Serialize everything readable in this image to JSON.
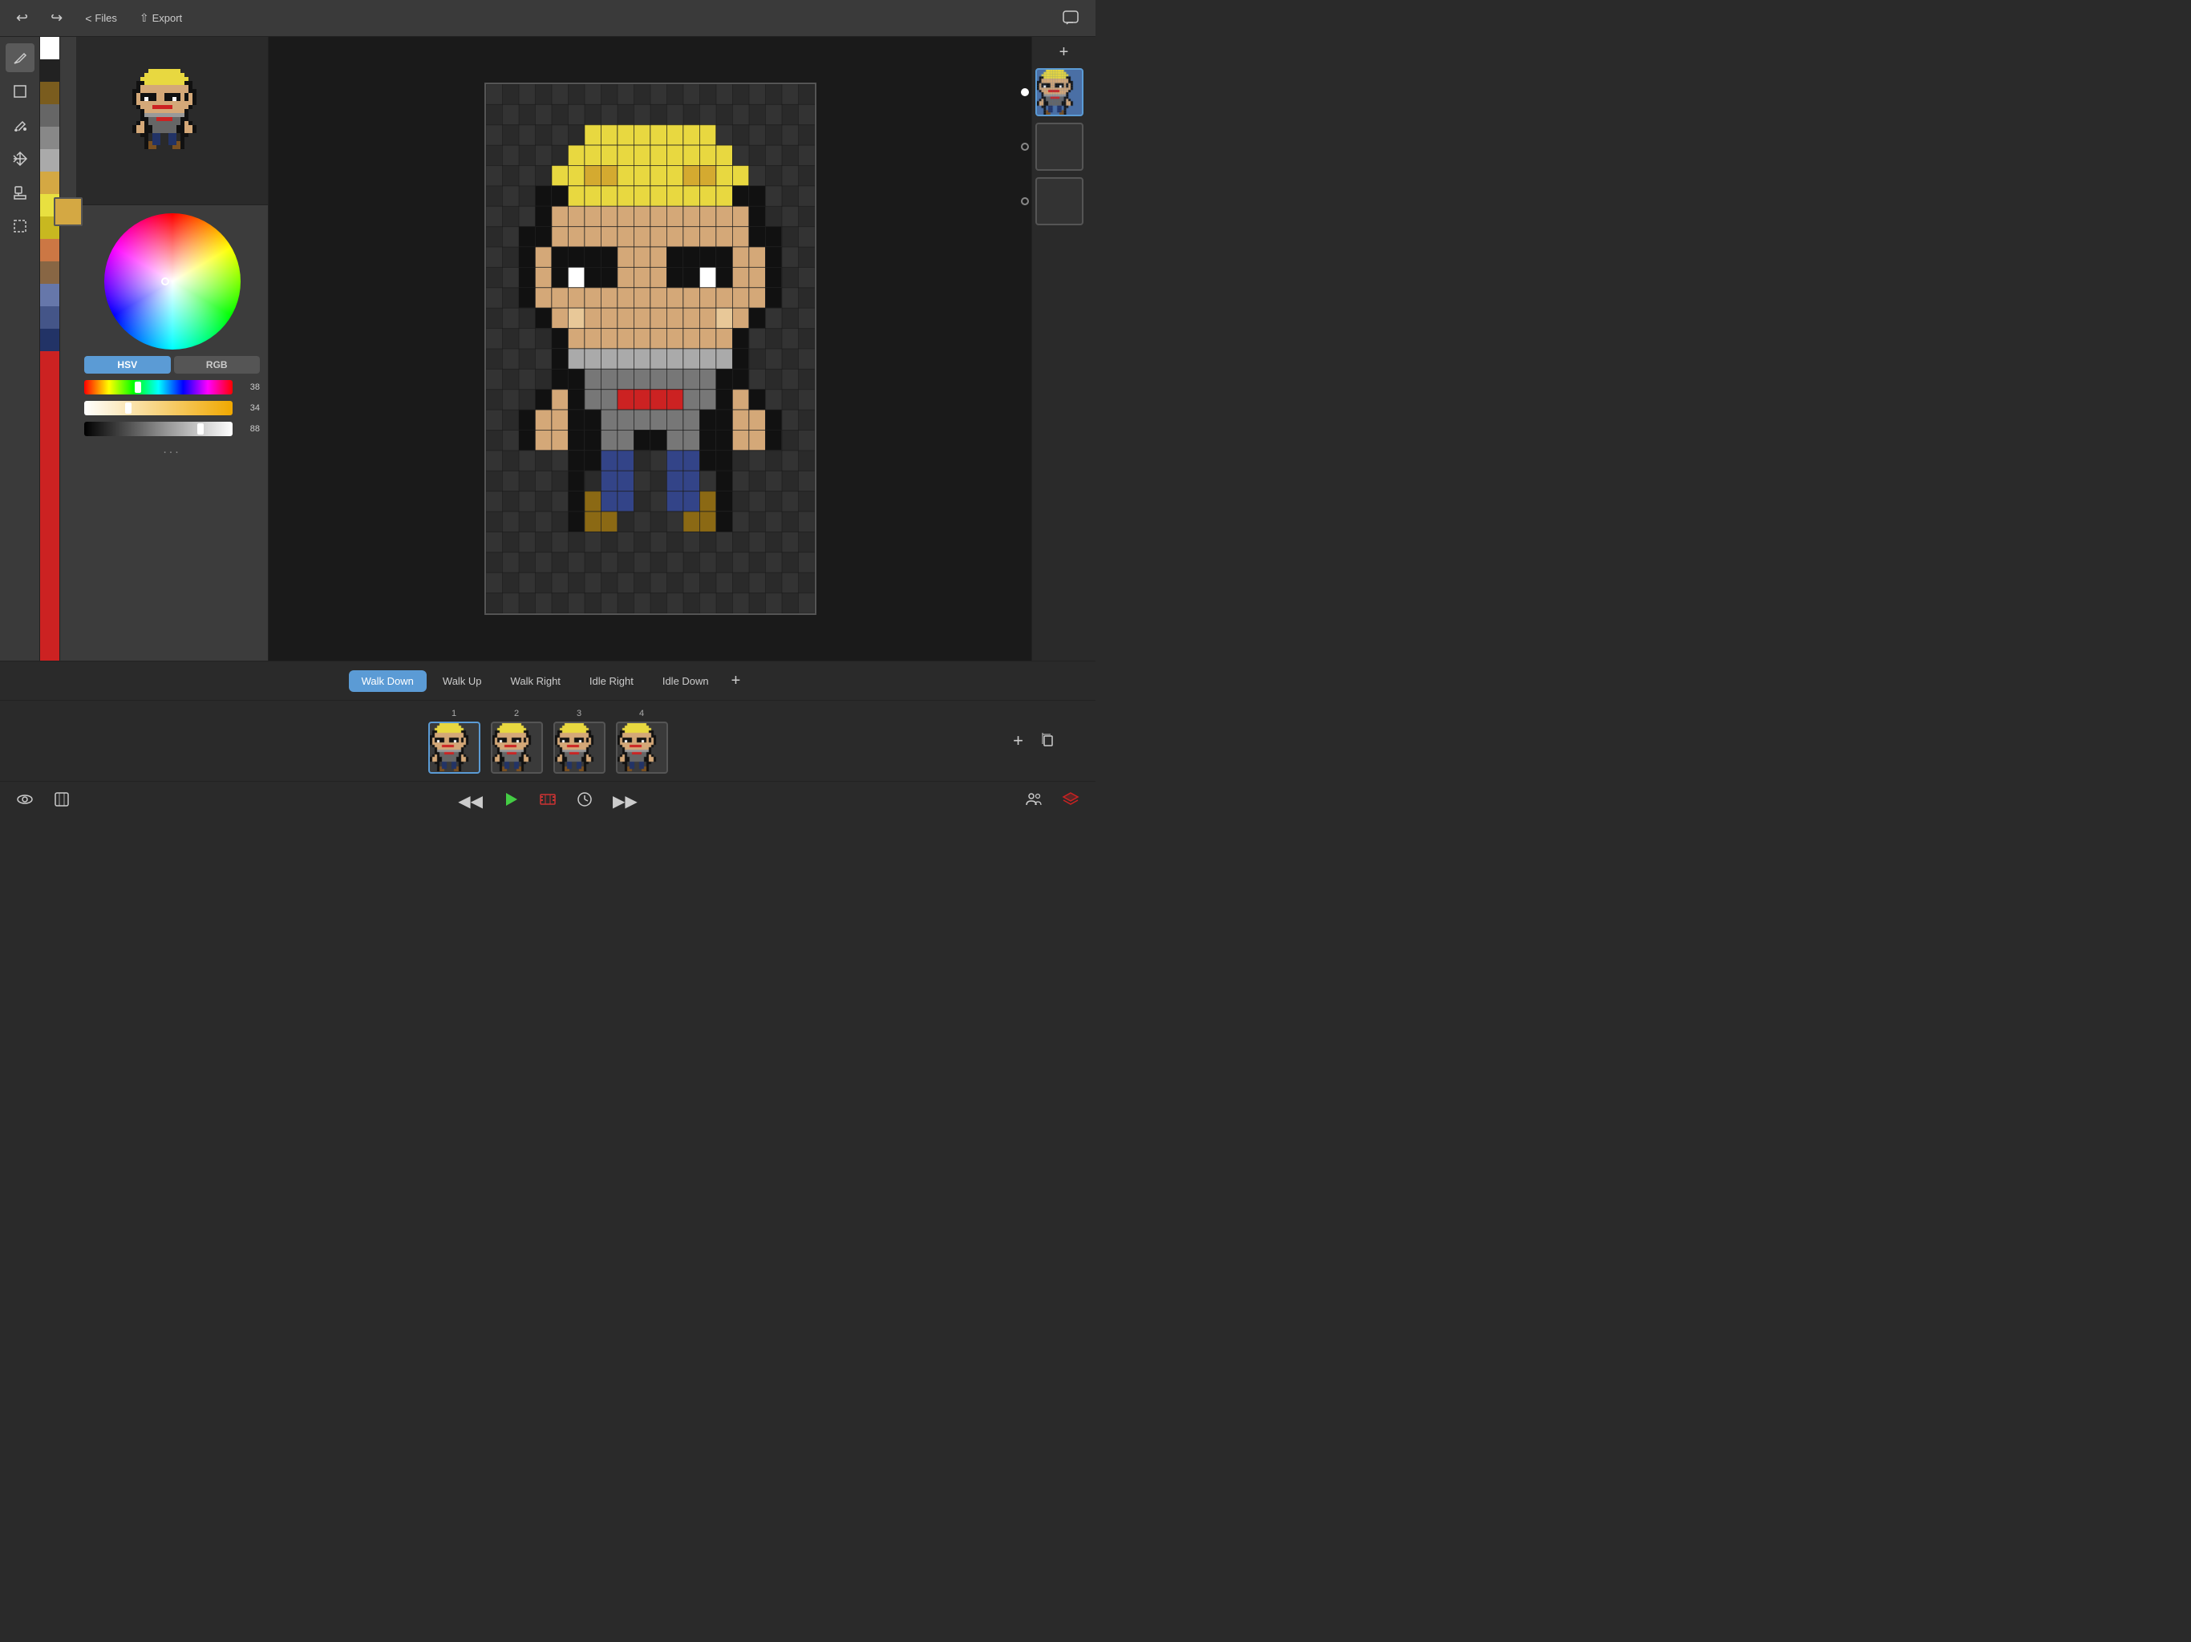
{
  "toolbar": {
    "undo_label": "↩",
    "redo_label": "↪",
    "files_label": "Files",
    "export_label": "Export",
    "chat_label": "💬",
    "add_label": "+"
  },
  "tools": [
    {
      "name": "pencil",
      "icon": "✏️",
      "active": true
    },
    {
      "name": "square",
      "icon": "□"
    },
    {
      "name": "fill",
      "icon": "🪣"
    },
    {
      "name": "move",
      "icon": "✥"
    },
    {
      "name": "stamp",
      "icon": "🔖"
    },
    {
      "name": "select",
      "icon": "⬚"
    }
  ],
  "color_palette": [
    "#FFFFFF",
    "#000000",
    "#8B6914",
    "#666666",
    "#999999",
    "#BBBBBB",
    "#D4A843",
    "#E8E040",
    "#C8B820",
    "#8B4513",
    "#CC7744",
    "#886644",
    "#6677AA",
    "#445588",
    "#223366",
    "#CC2222"
  ],
  "color_picker": {
    "active_color": "#D4A843",
    "mode": "HSV",
    "hsv_values": {
      "h": 38,
      "s": 34,
      "v": 88
    }
  },
  "animation_tabs": [
    {
      "label": "Walk Down",
      "active": true
    },
    {
      "label": "Walk Up",
      "active": false
    },
    {
      "label": "Walk Right",
      "active": false
    },
    {
      "label": "Idle Right",
      "active": false
    },
    {
      "label": "Idle Down",
      "active": false
    }
  ],
  "frames": [
    {
      "number": "1",
      "selected": true
    },
    {
      "number": "2",
      "selected": false
    },
    {
      "number": "3",
      "selected": false
    },
    {
      "number": "4",
      "selected": false
    }
  ],
  "layers": [
    {
      "name": "layer1",
      "active": true
    },
    {
      "name": "layer2",
      "active": false
    },
    {
      "name": "layer3",
      "active": false
    }
  ],
  "bottom_controls": {
    "rewind": "⏮",
    "play": "▶",
    "film": "🎞",
    "clock": "🕐",
    "forward": "⏭",
    "people": "👥",
    "layers": "🗂"
  }
}
